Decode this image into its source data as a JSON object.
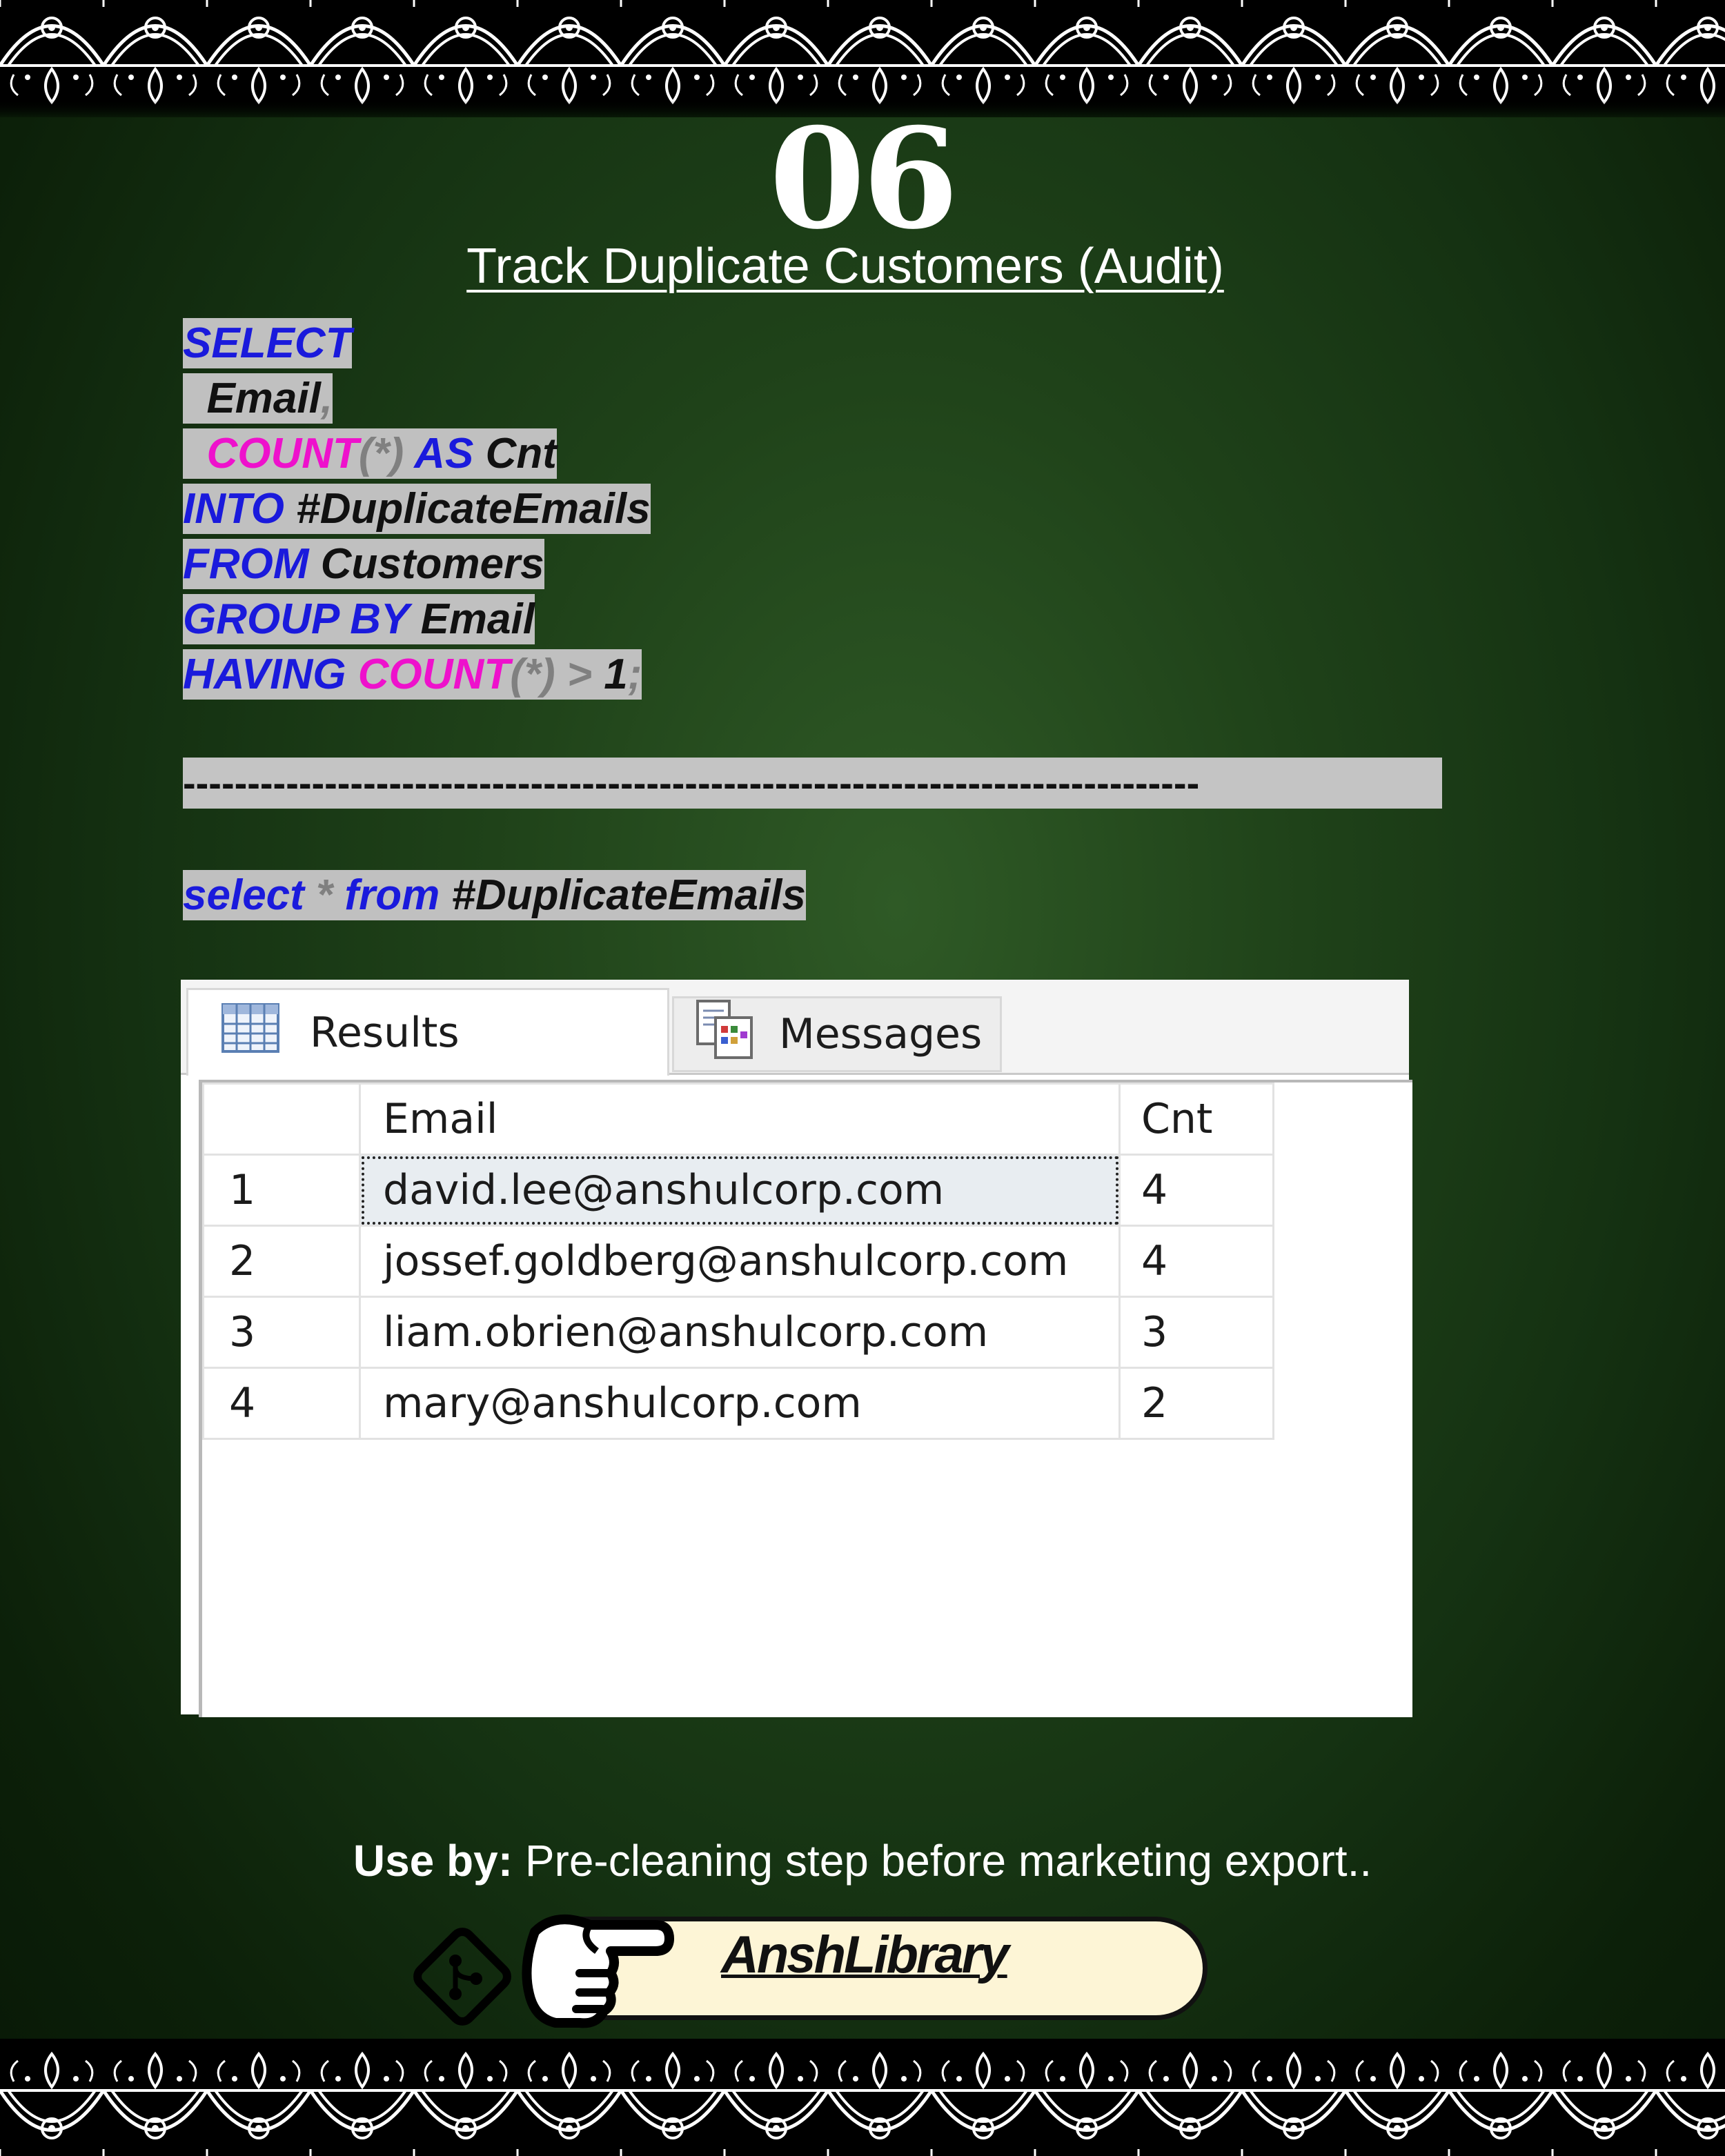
{
  "page_number": "06",
  "title": "Track Duplicate Customers (Audit)",
  "query": {
    "line1": {
      "kw": "SELECT"
    },
    "line2": {
      "col": "  Email",
      "punct": ","
    },
    "line3": {
      "indent": "  ",
      "fn": "COUNT",
      "args": "(*)",
      "kw": "AS",
      "alias": "Cnt"
    },
    "line4": {
      "kw": "INTO",
      "target": "#DuplicateEmails"
    },
    "line5": {
      "kw": "FROM",
      "table": "Customers"
    },
    "line6": {
      "kw": "GROUP BY",
      "col": "Email"
    },
    "line7": {
      "kw": "HAVING",
      "fn": "COUNT",
      "args": "(*)",
      "op": ">",
      "num": "1",
      "end": ";"
    }
  },
  "separator": "-------------------------------------------------------------------------------",
  "select_query": {
    "kw1": "select",
    "star": "*",
    "kw2": "from",
    "table": "#DuplicateEmails"
  },
  "results": {
    "tabs": [
      {
        "label": "Results",
        "icon": "grid-icon"
      },
      {
        "label": "Messages",
        "icon": "messages-icon"
      }
    ],
    "columns": [
      "",
      "Email",
      "Cnt"
    ],
    "rows": [
      {
        "idx": "1",
        "email": "david.lee@anshulcorp.com",
        "cnt": "4"
      },
      {
        "idx": "2",
        "email": "jossef.goldberg@anshulcorp.com",
        "cnt": "4"
      },
      {
        "idx": "3",
        "email": "liam.obrien@anshulcorp.com",
        "cnt": "3"
      },
      {
        "idx": "4",
        "email": "mary@anshulcorp.com",
        "cnt": "2"
      }
    ],
    "selected_row": 0
  },
  "use_by": {
    "label": "Use by:",
    "text": " Pre-cleaning step before marketing export.."
  },
  "footer": {
    "brand": "AnshLibrary",
    "icons": [
      "git-icon",
      "pointing-hand-icon"
    ]
  },
  "colors": {
    "keyword": "#1a1adc",
    "function": "#ee11cc",
    "punctuation": "#808080",
    "highlight": "#c0c0c0"
  }
}
